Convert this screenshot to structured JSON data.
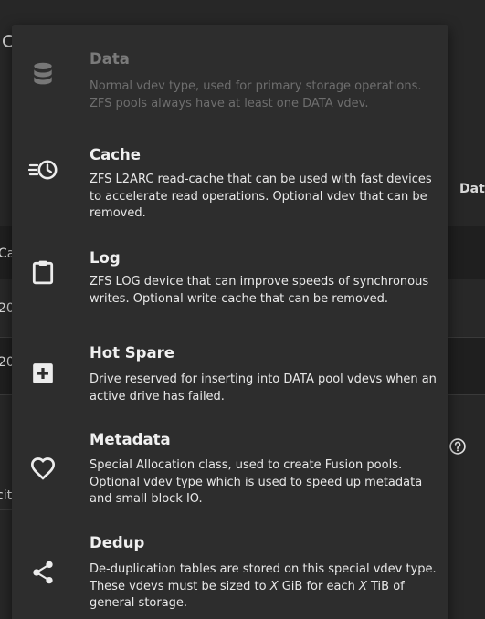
{
  "background": {
    "fragments": [
      "Dat",
      "Ca",
      "20",
      "20",
      "cit"
    ]
  },
  "menu": {
    "items": [
      {
        "title": "Data",
        "description": "Normal vdev type, used for primary storage operations. ZFS pools always have at least one DATA vdev.",
        "icon": "database-icon",
        "disabled": true
      },
      {
        "title": "Cache",
        "description": "ZFS L2ARC read-cache that can be used with fast devices to accelerate read operations. Optional vdev that can be removed.",
        "icon": "clock-fast-icon",
        "disabled": false
      },
      {
        "title": "Log",
        "description": "ZFS LOG device that can improve speeds of synchronous writes. Optional write-cache that can be removed.",
        "icon": "clipboard-icon",
        "disabled": false
      },
      {
        "title": "Hot Spare",
        "description": "Drive reserved for inserting into DATA pool vdevs when an active drive has failed.",
        "icon": "plus-box-icon",
        "disabled": false
      },
      {
        "title": "Metadata",
        "description": "Special Allocation class, used to create Fusion pools. Optional vdev type which is used to speed up metadata and small block IO.",
        "icon": "heart-outline-icon",
        "disabled": false
      },
      {
        "title": "Dedup",
        "description_parts": [
          "De-duplication tables are stored on this special vdev type. These vdevs must be sized to ",
          "X",
          " GiB for each ",
          "X",
          " TiB of general storage."
        ],
        "icon": "share-icon",
        "disabled": false
      }
    ]
  }
}
